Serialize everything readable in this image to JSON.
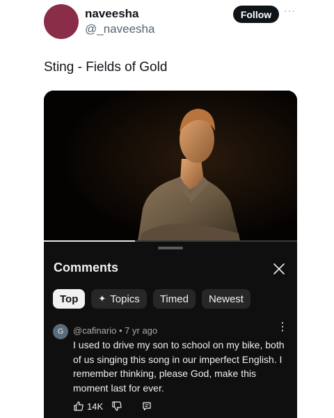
{
  "post": {
    "display_name": "naveesha",
    "handle": "@_naveesha",
    "follow_label": "Follow",
    "more_label": "···",
    "text": "Sting - Fields of Gold",
    "avatar_color": "#8a2d48"
  },
  "video": {
    "progress_fraction": 0.36
  },
  "comments_sheet": {
    "title": "Comments",
    "close_icon": "close-icon",
    "chips": [
      {
        "label": "Top",
        "active": true
      },
      {
        "label": "Topics",
        "icon": "sparkle-icon",
        "icon_glyph": "✦"
      },
      {
        "label": "Timed"
      },
      {
        "label": "Newest"
      }
    ],
    "comment": {
      "avatar_letter": "G",
      "author": "@cafinario",
      "separator": "•",
      "age": "7 yr ago",
      "body": "I used to drive my son to school on my bike, both of us singing this song in our imperfect English. I remember thinking, please God, make this moment last for ever.",
      "likes": "14K",
      "kebab_glyph": "⋮"
    }
  },
  "colors": {
    "sheet_bg": "#0f0f0f",
    "chip_bg": "#272727",
    "chip_active_bg": "#f1f1f1",
    "follow_bg": "#0f1419"
  }
}
